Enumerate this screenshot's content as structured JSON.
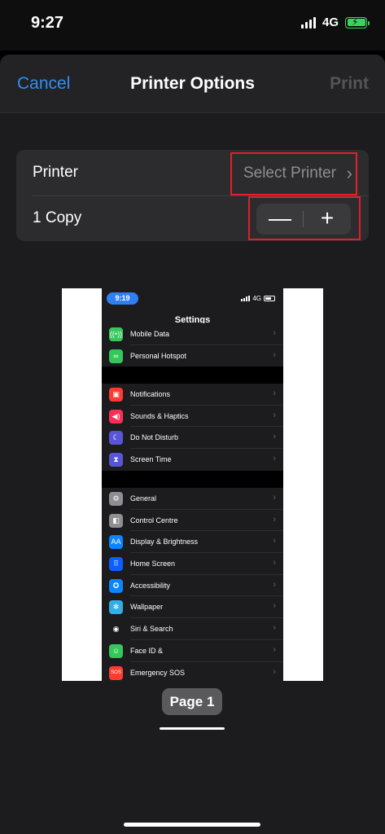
{
  "status_bar": {
    "time": "9:27",
    "network": "4G"
  },
  "nav": {
    "cancel": "Cancel",
    "title": "Printer Options",
    "print": "Print"
  },
  "options": {
    "printer_label": "Printer",
    "printer_value": "Select Printer",
    "copies_label": "1 Copy",
    "stepper_minus": "—",
    "stepper_plus": "+"
  },
  "preview": {
    "status_time": "9:19",
    "status_network": "4G",
    "header": "Settings",
    "page_label": "Page 1",
    "group1": [
      {
        "label": "Mobile Data",
        "icon": "antenna-icon",
        "color": "#34c759",
        "glyph": "((•))"
      },
      {
        "label": "Personal Hotspot",
        "icon": "hotspot-icon",
        "color": "#34c759",
        "glyph": "∞"
      }
    ],
    "group2": [
      {
        "label": "Notifications",
        "icon": "notifications-icon",
        "color": "#ff3b30",
        "glyph": "▣"
      },
      {
        "label": "Sounds & Haptics",
        "icon": "speaker-icon",
        "color": "#ff2d55",
        "glyph": "◀)"
      },
      {
        "label": "Do Not Disturb",
        "icon": "moon-icon",
        "color": "#5856d6",
        "glyph": "☾"
      },
      {
        "label": "Screen Time",
        "icon": "hourglass-icon",
        "color": "#5856d6",
        "glyph": "⧗"
      }
    ],
    "group3": [
      {
        "label": "General",
        "icon": "gear-icon",
        "color": "#8e8e93",
        "glyph": "⚙"
      },
      {
        "label": "Control Centre",
        "icon": "toggles-icon",
        "color": "#8e8e93",
        "glyph": "◧"
      },
      {
        "label": "Display & Brightness",
        "icon": "display-icon",
        "color": "#0a84ff",
        "glyph": "AA"
      },
      {
        "label": "Home Screen",
        "icon": "grid-icon",
        "color": "#0a60ff",
        "glyph": "⠿"
      },
      {
        "label": "Accessibility",
        "icon": "accessibility-icon",
        "color": "#0a84ff",
        "glyph": "✪"
      },
      {
        "label": "Wallpaper",
        "icon": "flower-icon",
        "color": "#32ade6",
        "glyph": "✻"
      },
      {
        "label": "Siri & Search",
        "icon": "siri-icon",
        "color": "#1c1c1e",
        "glyph": "◉"
      },
      {
        "label": "Face ID &",
        "icon": "faceid-icon",
        "color": "#34c759",
        "glyph": "☺"
      },
      {
        "label": "Emergency SOS",
        "icon": "sos-icon",
        "color": "#ff3b30",
        "glyph": "SOS"
      }
    ]
  }
}
